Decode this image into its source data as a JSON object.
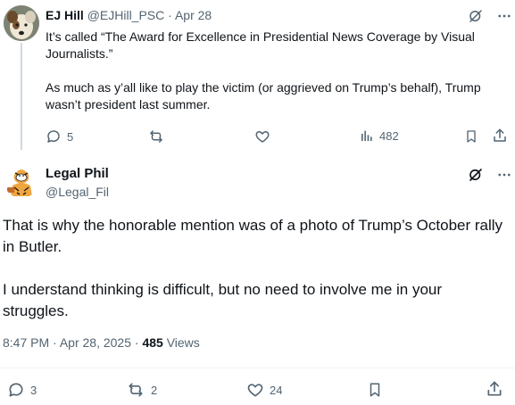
{
  "parent": {
    "display_name": "EJ Hill",
    "handle": "@EJHill_PSC",
    "separator": "·",
    "date": "Apr 28",
    "paragraphs": [
      "It’s called “The Award for Excellence in Presidential News Coverage by Visual Journalists.”",
      "As much as y’all like to play the victim (or aggrieved on Trump’s behalf), Trump wasn’t president last summer."
    ],
    "actions": {
      "replies": "5",
      "views": "482"
    }
  },
  "main": {
    "display_name": "Legal Phil",
    "handle": "@Legal_Fil",
    "paragraphs": [
      "That is why the honorable mention was of a photo of Trump’s October rally in Butler.",
      "I understand thinking is difficult, but no need to involve me in your struggles."
    ],
    "meta": {
      "time": "8:47 PM",
      "separator": "·",
      "date": "Apr 28, 2025",
      "views_count": "485",
      "views_label": "Views"
    },
    "actions": {
      "replies": "3",
      "reposts": "2",
      "likes": "24"
    }
  },
  "icons": {
    "grok": "grok-slash-icon",
    "more": "more-dots-icon",
    "reply": "reply-bubble-icon",
    "repost": "repost-arrows-icon",
    "like": "heart-icon",
    "views": "bar-chart-icon",
    "bookmark": "bookmark-icon",
    "share": "share-upload-icon"
  },
  "colors": {
    "text": "#0f1419",
    "muted": "#536471",
    "thread_line": "#cfd9de",
    "divider": "#eff3f4"
  }
}
